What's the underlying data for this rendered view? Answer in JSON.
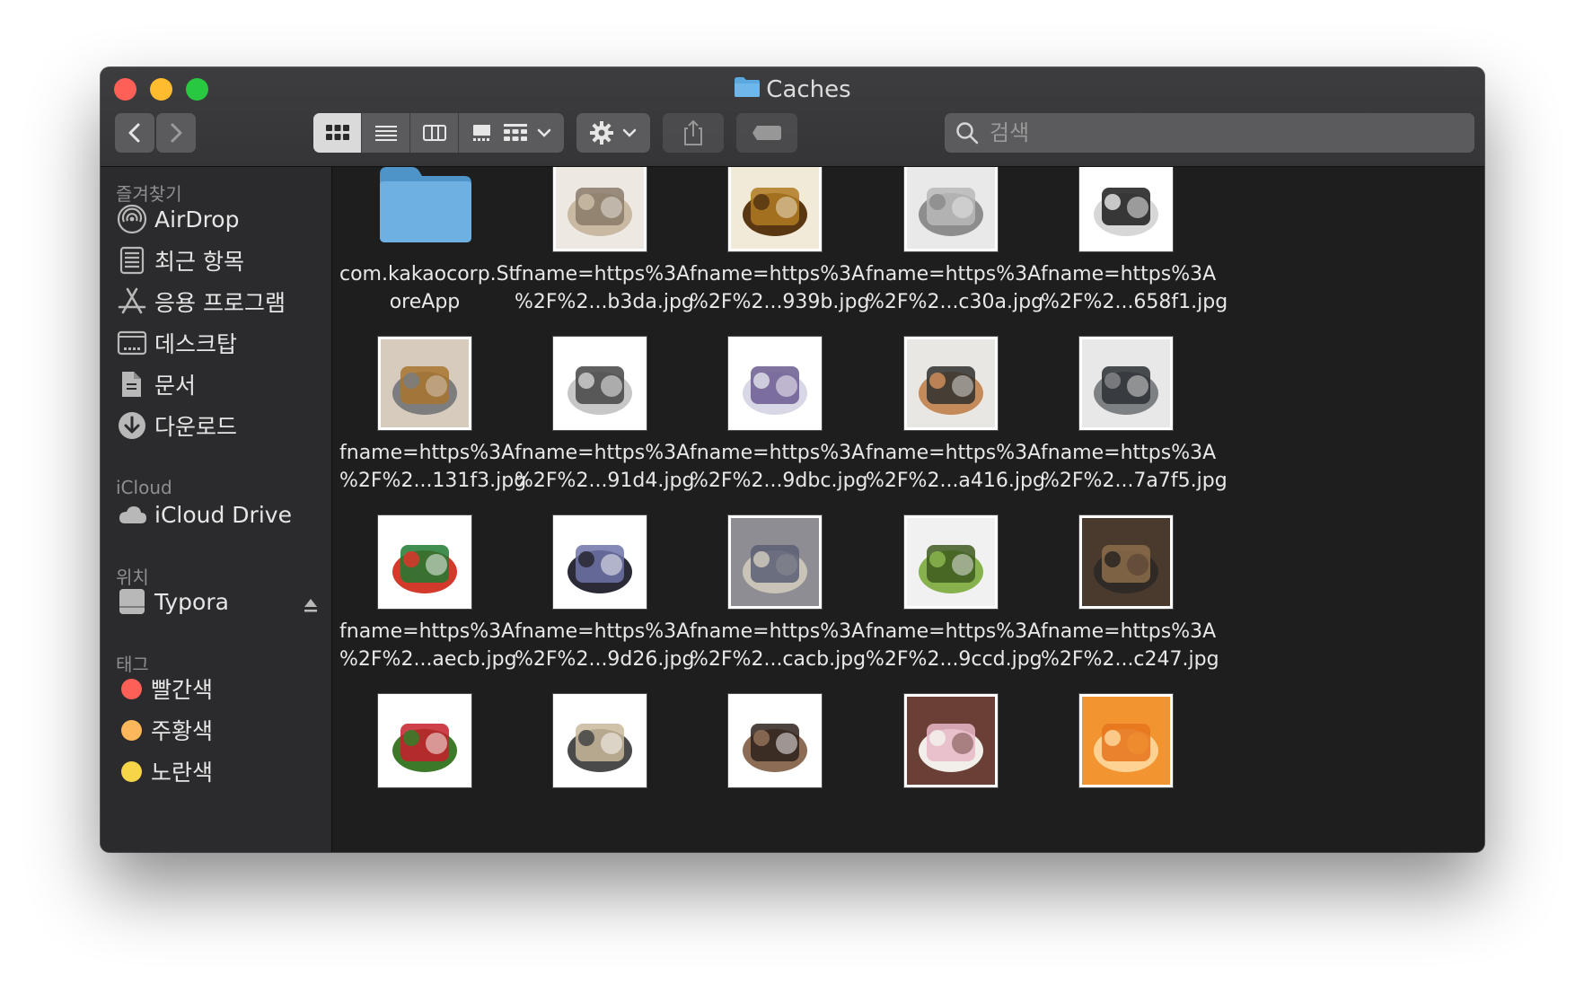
{
  "window": {
    "title": "Caches"
  },
  "toolbar": {
    "search_placeholder": "검색",
    "view_modes": [
      "icon-view",
      "list-view",
      "column-view",
      "gallery-view"
    ],
    "active_view": "icon-view"
  },
  "sidebar": {
    "favorites_header": "즐겨찾기",
    "favorites": [
      {
        "label": "AirDrop",
        "icon": "airdrop-icon"
      },
      {
        "label": "최근 항목",
        "icon": "recents-icon"
      },
      {
        "label": "응용 프로그램",
        "icon": "applications-icon"
      },
      {
        "label": "데스크탑",
        "icon": "desktop-icon"
      },
      {
        "label": "문서",
        "icon": "documents-icon"
      },
      {
        "label": "다운로드",
        "icon": "downloads-icon"
      }
    ],
    "icloud_header": "iCloud",
    "icloud": [
      {
        "label": "iCloud Drive",
        "icon": "cloud-icon"
      }
    ],
    "locations_header": "위치",
    "locations": [
      {
        "label": "Typora",
        "icon": "disk-icon"
      }
    ],
    "tags_header": "태그",
    "tags": [
      {
        "label": "빨간색",
        "color": "#fe5f57"
      },
      {
        "label": "주황색",
        "color": "#fdb75b"
      },
      {
        "label": "노란색",
        "color": "#f6d548"
      }
    ]
  },
  "files": [
    {
      "name": "com.kakaocorp.St\noreApp",
      "kind": "folder"
    },
    {
      "name": "fname=https%3A\n%2F%2...b3da.jpg",
      "kind": "image",
      "palette": [
        "#ede8e1",
        "#8a7a6a",
        "#c9b9a3"
      ]
    },
    {
      "name": "fname=https%3A\n%2F%2...939b.jpg",
      "kind": "image",
      "palette": [
        "#f2ead8",
        "#b07a22",
        "#5a3713"
      ]
    },
    {
      "name": "fname=https%3A\n%2F%2...c30a.jpg",
      "kind": "image",
      "palette": [
        "#e9e9e9",
        "#b9b9b9",
        "#8d8d8d"
      ]
    },
    {
      "name": "fname=https%3A\n%2F%2...658f1.jpg",
      "kind": "image",
      "palette": [
        "#ffffff",
        "#1b1b1b",
        "#d7d7d7"
      ]
    },
    {
      "name": "fname=https%3A\n%2F%2...131f3.jpg",
      "kind": "image",
      "palette": [
        "#d6cbbd",
        "#a8742e",
        "#7d7d7d"
      ]
    },
    {
      "name": "fname=https%3A\n%2F%2...91d4.jpg",
      "kind": "image",
      "palette": [
        "#ffffff",
        "#444444",
        "#c7c7c7"
      ]
    },
    {
      "name": "fname=https%3A\n%2F%2...9dbc.jpg",
      "kind": "image",
      "palette": [
        "#ffffff",
        "#6b5b8f",
        "#d7d7e6"
      ]
    },
    {
      "name": "fname=https%3A\n%2F%2...a416.jpg",
      "kind": "image",
      "palette": [
        "#e9e7e3",
        "#2f2f2f",
        "#c58a59"
      ]
    },
    {
      "name": "fname=https%3A\n%2F%2...7a7f5.jpg",
      "kind": "image",
      "palette": [
        "#e8e8e8",
        "#2c2f33",
        "#7e8184"
      ]
    },
    {
      "name": "fname=https%3A\n%2F%2...aecb.jpg",
      "kind": "image",
      "palette": [
        "#ffffff",
        "#1e7b32",
        "#d33a2c"
      ]
    },
    {
      "name": "fname=https%3A\n%2F%2...9d26.jpg",
      "kind": "image",
      "palette": [
        "#ffffff",
        "#6f73a8",
        "#2b2b38"
      ]
    },
    {
      "name": "fname=https%3A\n%2F%2...cacb.jpg",
      "kind": "image",
      "palette": [
        "#8d8d93",
        "#5a5f73",
        "#c9c3b8"
      ]
    },
    {
      "name": "fname=https%3A\n%2F%2...9ccd.jpg",
      "kind": "image",
      "palette": [
        "#f1f1f1",
        "#3d5a1e",
        "#86b14d"
      ]
    },
    {
      "name": "fname=https%3A\n%2F%2...c247.jpg",
      "kind": "image",
      "palette": [
        "#4a3a2e",
        "#8c6c4a",
        "#2f2a26"
      ]
    },
    {
      "name": "",
      "kind": "image",
      "palette": [
        "#ffffff",
        "#c51f2a",
        "#3c7a2a"
      ]
    },
    {
      "name": "",
      "kind": "image",
      "palette": [
        "#ffffff",
        "#c9b99a",
        "#4a4a4a"
      ]
    },
    {
      "name": "",
      "kind": "image",
      "palette": [
        "#ffffff",
        "#2d211c",
        "#8c6c55"
      ]
    },
    {
      "name": "",
      "kind": "image",
      "palette": [
        "#6a4036",
        "#e8b9c8",
        "#f2eee9"
      ]
    },
    {
      "name": "",
      "kind": "image",
      "palette": [
        "#f29430",
        "#e6741b",
        "#fdd293"
      ]
    }
  ]
}
